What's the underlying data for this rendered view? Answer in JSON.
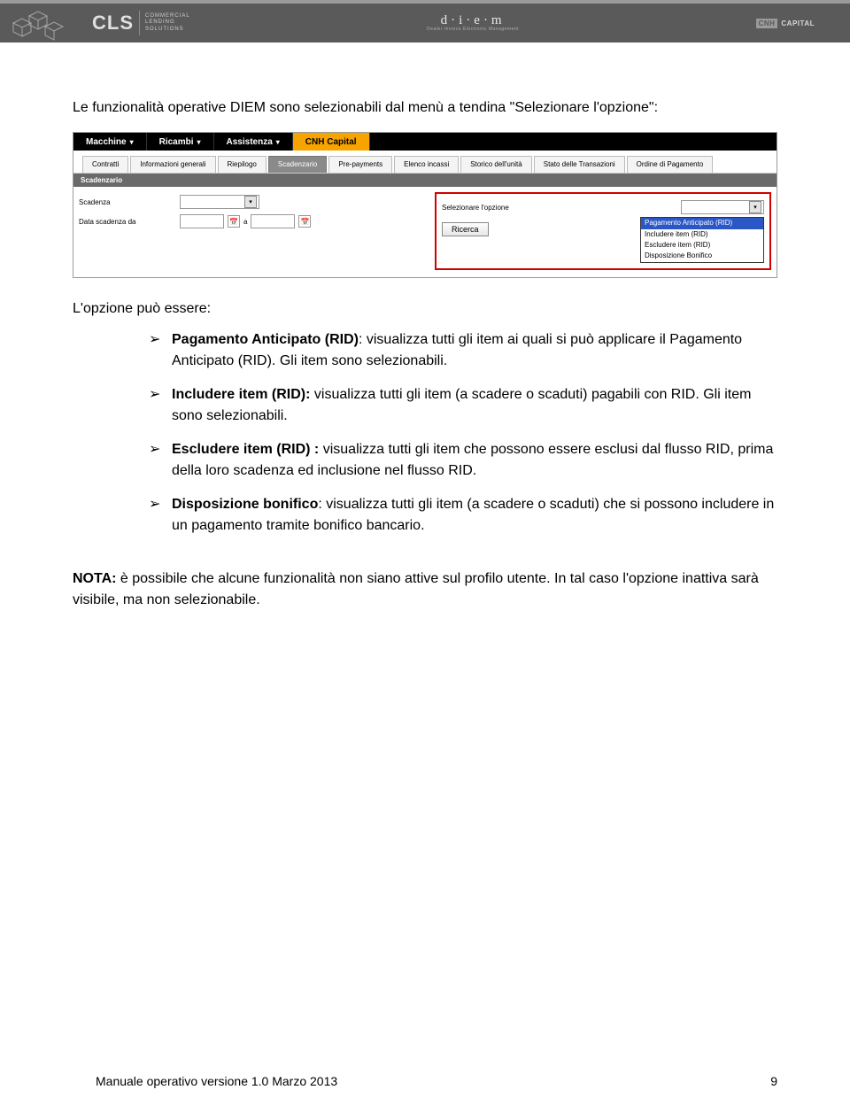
{
  "banner": {
    "cls_mark": "CLS",
    "cls_tag_l1": "COMMERCIAL",
    "cls_tag_l2": "LENDING",
    "cls_tag_l3": "SOLUTIONS",
    "diem_mark": "d·i·e·m",
    "diem_sub": "Dealer Invoice Electronic Management",
    "cnh_box": "CNH",
    "cnh_cap": "CAPITAL"
  },
  "intro": "Le funzionalità operative DIEM sono selezionabili dal menù a tendina \"Selezionare l'opzione\":",
  "screenshot": {
    "menu": [
      "Macchine",
      "Ricambi",
      "Assistenza",
      "CNH Capital"
    ],
    "menu_active_idx": 3,
    "tabs": [
      "Contratti",
      "Informazioni generali",
      "Riepilogo",
      "Scadenzario",
      "Pre-payments",
      "Elenco incassi",
      "Storico dell'unità",
      "Stato delle Transazioni",
      "Ordine di Pagamento"
    ],
    "tabs_active_idx": 3,
    "section_title": "Scadenzario",
    "left": {
      "scadenza_label": "Scadenza",
      "data_label": "Data scadenza da",
      "a_label": "a"
    },
    "right": {
      "opzione_label": "Selezionare l'opzione",
      "ricerca_btn": "Ricerca",
      "options": [
        "Pagamento Anticipato (RID)",
        "Includere item (RID)",
        "Escludere item (RID)",
        "Disposizione Bonifico"
      ]
    }
  },
  "post": "L'opzione può essere:",
  "bullets": [
    {
      "strong": "Pagamento Anticipato (RID)",
      "sep": ": ",
      "rest": "visualizza tutti gli item ai quali si può applicare il Pagamento Anticipato (RID). Gli item sono selezionabili."
    },
    {
      "strong": "Includere item (RID):",
      "sep": " ",
      "rest": "visualizza tutti gli item (a scadere o scaduti) pagabili con RID. Gli item sono selezionabili."
    },
    {
      "strong": "Escludere item (RID) :",
      "sep": "  ",
      "rest": "visualizza tutti gli item che possono essere esclusi dal flusso RID, prima della loro scadenza ed inclusione nel flusso RID."
    },
    {
      "strong": "Disposizione bonifico",
      "sep": ": ",
      "rest": "visualizza tutti gli item (a scadere o scaduti) che si possono includere in un pagamento tramite bonifico bancario."
    }
  ],
  "note": {
    "label": "NOTA:",
    "text": "  è possibile che alcune funzionalità non siano attive sul profilo utente. In tal caso l'opzione inattiva sarà visibile, ma non selezionabile."
  },
  "footer": {
    "left": "Manuale operativo versione 1.0     Marzo 2013",
    "right": "9"
  }
}
